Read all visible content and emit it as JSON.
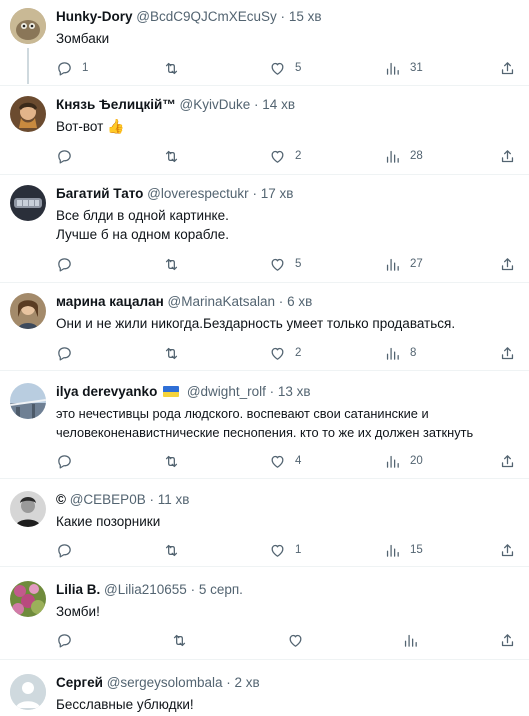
{
  "tweets": [
    {
      "name": "Hunky-Dory",
      "handle": "@BcdC9QJCmXEcuSy",
      "time": "15 хв",
      "lines": [
        "Зомбаки"
      ],
      "replies": "1",
      "likes": "5",
      "views": "31"
    },
    {
      "name": "Князь Ѣелицкій™",
      "handle": "@KyivDuke",
      "time": "14 хв",
      "lines": [
        "Вот-вот"
      ],
      "emoji": "👍",
      "replies": "",
      "likes": "2",
      "views": "28"
    },
    {
      "name": "Багатий Тато",
      "handle": "@loverespectukr",
      "time": "17 хв",
      "lines": [
        "Все блди в одной картинке.",
        "Лучше б на одном корабле."
      ],
      "replies": "",
      "likes": "5",
      "views": "27"
    },
    {
      "name": "марина кацалан",
      "handle": "@MarinaKatsalan",
      "time": "6 хв",
      "lines": [
        "Они и не жили никогда.Бездарность умеет только продаваться."
      ],
      "replies": "",
      "likes": "2",
      "views": "8"
    },
    {
      "name": "ilya derevyanko",
      "handle": "@dwight_rolf",
      "time": "13 хв",
      "lines": [
        "это нечестивцы рода людского. воспевают свои сатанинские и",
        "человеконенавистнические песнопения. кто то же их должен заткнуть"
      ],
      "replies": "",
      "likes": "4",
      "views": "20"
    },
    {
      "name": "©",
      "handle": "@СЕВЕР0В",
      "time": "11 хв",
      "lines": [
        "Какие позорники"
      ],
      "replies": "",
      "likes": "1",
      "views": "15"
    },
    {
      "name": "Lilia B.",
      "handle": "@Lilia210655",
      "time": "5 серп.",
      "lines": [
        "Зомби!"
      ],
      "replies": "",
      "likes": "",
      "views": ""
    },
    {
      "name": "Сергей",
      "handle": "@sergeysolombala",
      "time": "2 хв",
      "lines": [
        "Бесславные ублюдки!"
      ],
      "replies": "",
      "likes": "",
      "views": ""
    }
  ],
  "dot": "·",
  "colors": {
    "text": "#0f1419",
    "secondary": "#536471",
    "divider": "#eff3f4"
  }
}
